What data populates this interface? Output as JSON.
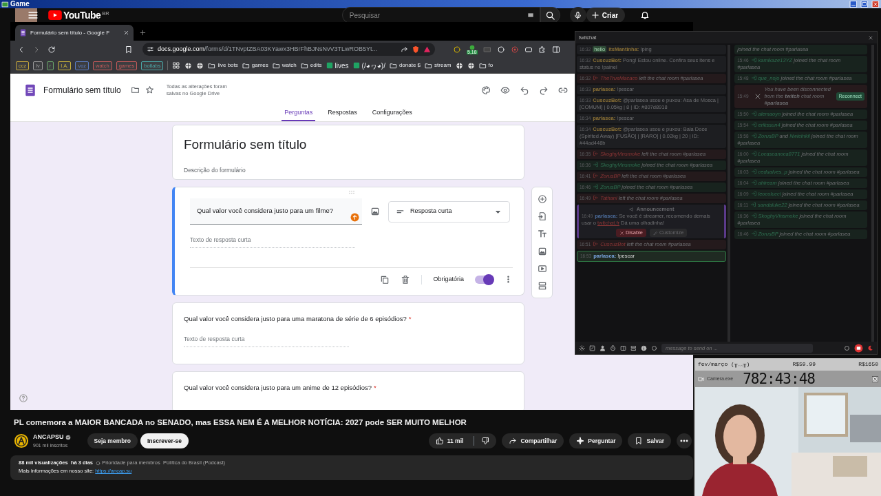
{
  "window": {
    "title": "Game"
  },
  "youtube": {
    "logo_text": "YouTube",
    "region": "BR",
    "search": {
      "placeholder": "Pesquisar"
    },
    "create_label": "Criar"
  },
  "browser": {
    "tabs": [
      {
        "title": "Formulário sem título - Google F",
        "selected": true
      }
    ],
    "address": {
      "host": "docs.google.com",
      "path": "/forms/d/1TNvptZBA03KYawx3HBrFhBJNsNvV3TLwROB5Yt..."
    },
    "extension_badge": "5,18",
    "bookmarks": [
      {
        "kind": "tag",
        "label": "ccz",
        "color": "#c9a93a"
      },
      {
        "kind": "tag",
        "label": "lv",
        "color": "#9a9a9a"
      },
      {
        "kind": "tag",
        "label": "r",
        "color": "#6aa86a"
      },
      {
        "kind": "tag",
        "label": "I.A.",
        "color": "#c9b23a"
      },
      {
        "kind": "tag",
        "label": "voz",
        "color": "#5a7ec8"
      },
      {
        "kind": "tag",
        "label": "watch",
        "color": "#c85a5a"
      },
      {
        "kind": "tag",
        "label": "games",
        "color": "#c85a5a"
      },
      {
        "kind": "tag",
        "label": "botlabs",
        "color": "#4aa8a8"
      },
      {
        "kind": "grid"
      },
      {
        "kind": "site"
      },
      {
        "kind": "site"
      },
      {
        "kind": "folder",
        "label": "live bots"
      },
      {
        "kind": "folder",
        "label": "games"
      },
      {
        "kind": "folder",
        "label": "watch"
      },
      {
        "kind": "folder",
        "label": "edits"
      },
      {
        "kind": "link",
        "label": "lives"
      },
      {
        "kind": "link",
        "label": "(/◕ヮ◕)/"
      },
      {
        "kind": "folder",
        "label": "donate $"
      },
      {
        "kind": "folder",
        "label": "stream"
      },
      {
        "kind": "site"
      },
      {
        "kind": "site"
      },
      {
        "kind": "folder",
        "label": "fo"
      }
    ]
  },
  "form": {
    "title": "Formulário sem título",
    "save_status": "Todas as alterações foram salvas no Google Drive",
    "tabs": [
      {
        "label": "Perguntas",
        "selected": true
      },
      {
        "label": "Respostas",
        "selected": false
      },
      {
        "label": "Configurações",
        "selected": false
      }
    ],
    "header_card": {
      "title": "Formulário sem título",
      "description_placeholder": "Descrição do formulário"
    },
    "questions": [
      {
        "text": "Qual valor você considera justo para um filme?",
        "active": true,
        "type": "Resposta curta",
        "answer_placeholder": "Texto de resposta curta",
        "required_label": "Obrigatória",
        "required": true
      },
      {
        "text": "Qual valor você considera justo para uma maratona de série de 6 episódios?",
        "active": false,
        "required_mark": "*",
        "answer_placeholder": "Texto de resposta curta"
      },
      {
        "text": "Qual valor você considera justo para um anime de 12 episódios?",
        "active": false,
        "required_mark": "*"
      }
    ]
  },
  "video": {
    "title": "PL comemora a MAIOR BANCADA no SENADO, mas ESSA NEM É A MELHOR NOTÍCIA: 2027 pode SER MUITO MELHOR",
    "channel": {
      "name": "ANCAPSU",
      "verified": true,
      "subscribers": "901 mil inscritos"
    },
    "join_label": "Seja membro",
    "subscribe_label": "Inscrever-se",
    "likes": "11 mil",
    "actions": [
      {
        "kind": "share",
        "label": "Compartilhar"
      },
      {
        "kind": "ask",
        "label": "Perguntar"
      },
      {
        "kind": "save",
        "label": "Salvar"
      }
    ],
    "description": {
      "views": "88 mil visualizações",
      "age": "há 3 dias",
      "badge": "Prioridade para membros",
      "category": "Política do Brasil (Podcast)",
      "text": "Mais informações em nosso site:",
      "link": "https://ancap.su"
    }
  },
  "chat": {
    "title": "twitchat",
    "columns": [
      {
        "entries": [
          {
            "kind": "message",
            "time": "16:32",
            "badge": "hello",
            "user": "itsMantinha:",
            "text": "!ping",
            "highlighted": false
          },
          {
            "kind": "message",
            "time": "16:32",
            "user": "CuscuzBot:",
            "text": "Pong! Estou online. Confira seus itens e status no !painel",
            "highlighted": false
          },
          {
            "kind": "left",
            "time": "16:32",
            "user": "TheTrueMacaco",
            "text": "left the chat room #parlasea"
          },
          {
            "kind": "message",
            "time": "16:33",
            "user": "parlasea:",
            "text": "!pescar",
            "highlighted": false
          },
          {
            "kind": "message",
            "time": "16:33",
            "user": "CuscuzBot:",
            "text": "@parlasea usou e puxou: Asa de Mosca | [COMUM] | 0.05kg | 8 | ID: #807d8918",
            "highlighted": false
          },
          {
            "kind": "message",
            "time": "16:34",
            "user": "parlasea:",
            "text": "!pescar",
            "highlighted": false
          },
          {
            "kind": "message",
            "time": "16:34",
            "user": "CuscuzBot:",
            "text": "@parlasea usou e puxou: Bala Doce (Spirited Away) [FUSÃO] | [RARO] | 0.02kg | 20 | ID: #44ad448b",
            "highlighted": false
          },
          {
            "kind": "left",
            "time": "16:35",
            "user": "SkoghyVinsmoke",
            "text": "left the chat room #parlasea"
          },
          {
            "kind": "joined",
            "time": "16:36",
            "users": [
              "SkoghyVinsmoke"
            ],
            "text": "joined the chat room #parlasea"
          },
          {
            "kind": "left",
            "time": "16:41",
            "user": "ZorusBP",
            "text": "left the chat room #parlasea"
          },
          {
            "kind": "joined",
            "time": "16:46",
            "users": [
              "ZorusBP"
            ],
            "text": "joined the chat room #parlasea"
          },
          {
            "kind": "left",
            "time": "16:49",
            "user": "Tathani",
            "text": "left the chat room #parlasea"
          },
          {
            "kind": "announcement",
            "heading": "Announcement",
            "time": "16:49",
            "user": "parlasea:",
            "text": "Se você é streamer, recomendo demais usar o",
            "link": "twitchat.fr",
            "after": "Dá uma olhadinha!",
            "buttons": [
              {
                "kind": "disable",
                "label": "Disable"
              },
              {
                "kind": "customize",
                "label": "Customize"
              }
            ]
          },
          {
            "kind": "left",
            "time": "16:51",
            "user": "CuscuzBot",
            "text": "left the chat room #parlasea"
          },
          {
            "kind": "message",
            "time": "16:53",
            "user": "parlasea:",
            "text": "!pescar",
            "highlighted": true
          }
        ]
      },
      {
        "entries": [
          {
            "kind": "joined",
            "text": "joined the chat room #parlasea"
          },
          {
            "kind": "joined",
            "time": "15:46",
            "users": [
              "kamikaze13YZ"
            ],
            "text": "joined the chat room #parlasea"
          },
          {
            "kind": "joined",
            "time": "15:48",
            "users": [
              "que_nojo"
            ],
            "text": "joined the chat room #parlasea"
          },
          {
            "kind": "disconnected",
            "time": "15:49",
            "text": "You have been disconnected from the **twitch** chat room **#parlasea**",
            "button": "Reconnect"
          },
          {
            "kind": "joined",
            "time": "15:50",
            "users": [
              "alemaoyn"
            ],
            "text": "joined the chat room #parlasea"
          },
          {
            "kind": "joined",
            "time": "15:54",
            "users": [
              "erikssun4"
            ],
            "text": "joined the chat room #parlasea"
          },
          {
            "kind": "joined",
            "time": "15:58",
            "users": [
              "ZorusBP",
              "Nwielnkil"
            ],
            "conjunction": "and",
            "text": "joined the chat room #parlasea"
          },
          {
            "kind": "joined",
            "time": "16:00",
            "users": [
              "Locascanoca8771"
            ],
            "text": "joined the chat room #parlasea"
          },
          {
            "kind": "joined",
            "time": "16:03",
            "users": [
              "cedualves_p"
            ],
            "text": "joined the chat room #parlasea"
          },
          {
            "kind": "joined",
            "time": "16:04",
            "users": [
              "ahiream"
            ],
            "text": "joined the chat room #parlasea"
          },
          {
            "kind": "joined",
            "time": "16:09",
            "users": [
              "leocolucci"
            ],
            "text": "joined the chat room #parlasea"
          },
          {
            "kind": "joined",
            "time": "16:11",
            "users": [
              "sandaluke22"
            ],
            "text": "joined the chat room #parlasea"
          },
          {
            "kind": "joined",
            "time": "16:36",
            "users": [
              "SkoghyVinsmoke"
            ],
            "text": "joined the chat room #parlasea"
          },
          {
            "kind": "joined",
            "time": "16:46",
            "users": [
              "ZorusBP"
            ],
            "text": "joined the chat room #parlasea"
          }
        ]
      }
    ],
    "input": {
      "placeholder": "message to send on ..."
    }
  },
  "stream_overlay": {
    "goal_label": "fev/março (╥﹏╥)",
    "current": "R$59.99",
    "goal": "R$1650",
    "timer_window": "Camera.exe",
    "timer": "782:43:48"
  }
}
